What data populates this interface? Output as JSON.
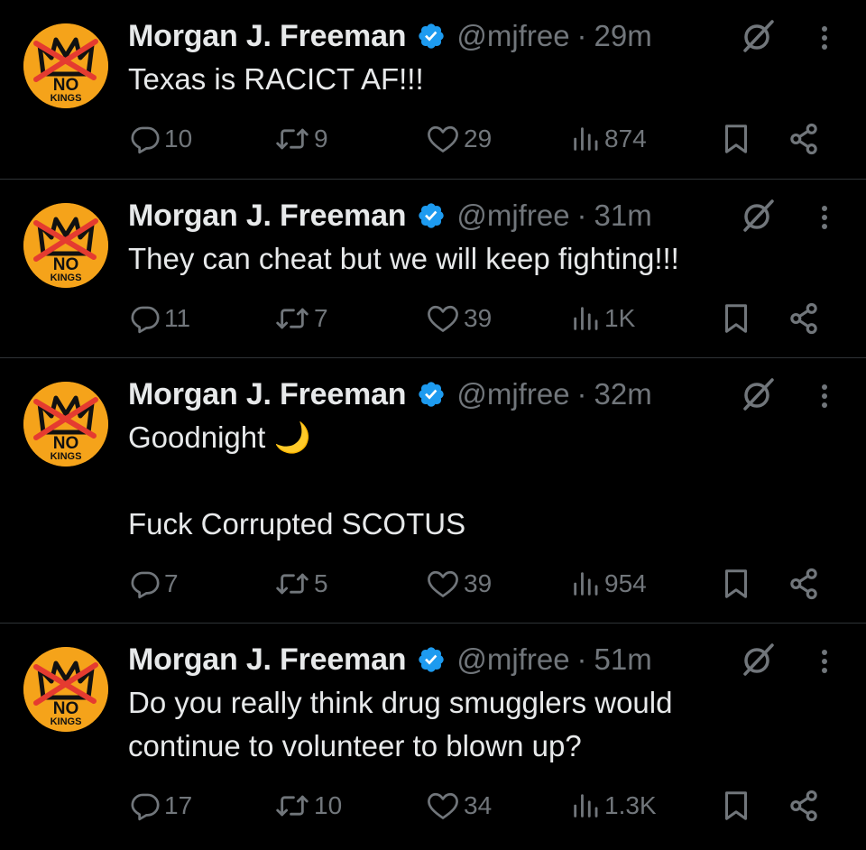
{
  "colors": {
    "background": "#000000",
    "text": "#e7e9ea",
    "muted": "#71767b",
    "divider": "#2f3336",
    "verified": "#1d9bf0",
    "avatar_bg": "#f5a31a"
  },
  "icons": {
    "reply": "reply-icon",
    "retweet": "retweet-icon",
    "like": "heart-icon",
    "views": "views-icon",
    "bookmark": "bookmark-icon",
    "share": "share-icon",
    "grok": "grok-icon",
    "more": "more-icon",
    "verified": "verified-badge-icon"
  },
  "avatar": {
    "line1": "NO",
    "line2": "KINGS"
  },
  "tweets": [
    {
      "name": "Morgan J. Freeman",
      "handle": "@mjfree",
      "separator": "·",
      "time": "29m",
      "lines": [
        "Texas is RACICT AF!!!"
      ],
      "replies": "10",
      "retweets": "9",
      "likes": "29",
      "views": "874"
    },
    {
      "name": "Morgan J. Freeman",
      "handle": "@mjfree",
      "separator": "·",
      "time": "31m",
      "lines": [
        "They can cheat but we will keep fighting!!!"
      ],
      "replies": "11",
      "retweets": "7",
      "likes": "39",
      "views": "1K"
    },
    {
      "name": "Morgan J. Freeman",
      "handle": "@mjfree",
      "separator": "·",
      "time": "32m",
      "lines": [
        "Goodnight 🌙",
        "Fuck Corrupted SCOTUS"
      ],
      "replies": "7",
      "retweets": "5",
      "likes": "39",
      "views": "954"
    },
    {
      "name": "Morgan J. Freeman",
      "handle": "@mjfree",
      "separator": "·",
      "time": "51m",
      "lines": [
        "Do you really think drug smugglers would",
        "continue to volunteer to blown up?"
      ],
      "replies": "17",
      "retweets": "10",
      "likes": "34",
      "views": "1.3K"
    }
  ]
}
